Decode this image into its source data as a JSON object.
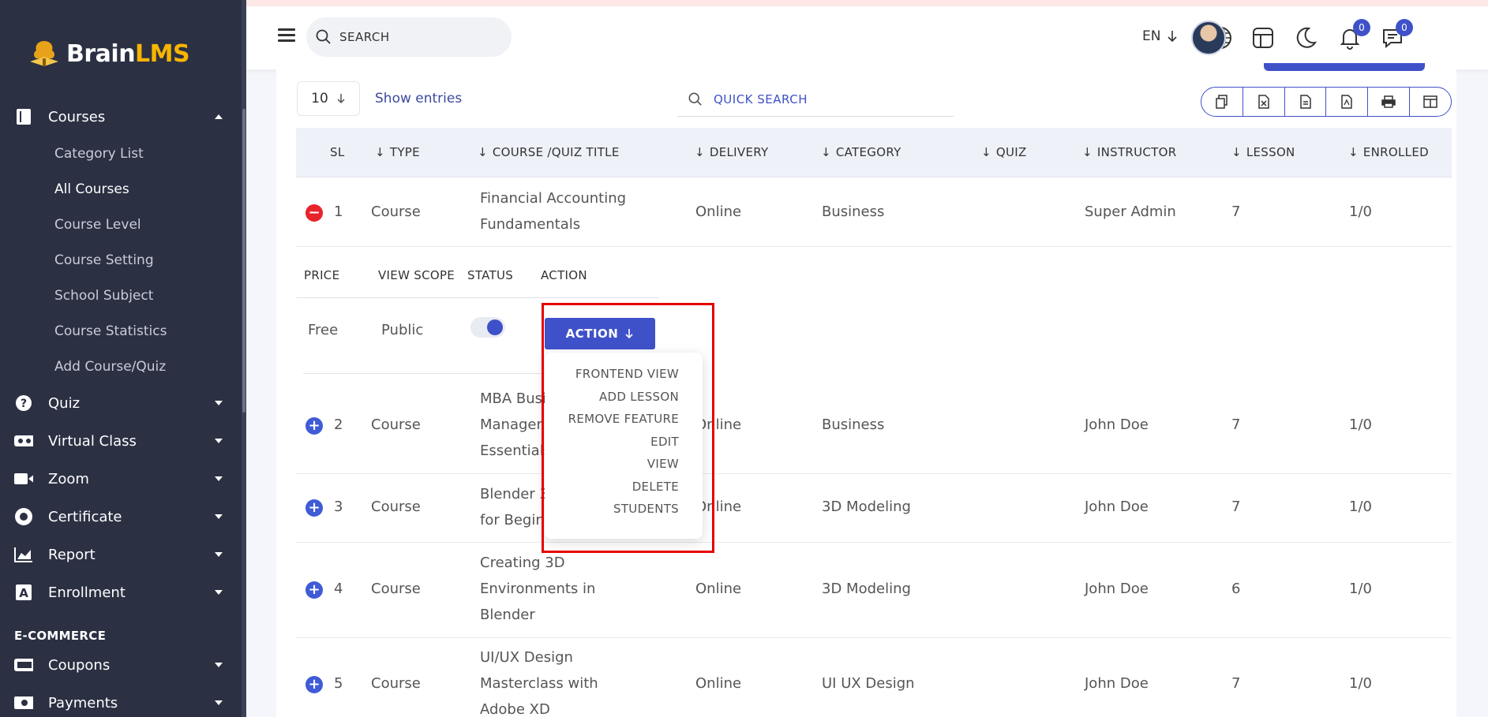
{
  "brand": {
    "name_a": "Brain",
    "name_b": "LMS"
  },
  "sidebar": {
    "courses": {
      "label": "Courses",
      "subitems": [
        "Category List",
        "All Courses",
        "Course Level",
        "Course Setting",
        "School Subject",
        "Course Statistics",
        "Add Course/Quiz"
      ],
      "active": "All Courses"
    },
    "items": [
      {
        "label": "Quiz",
        "icon": "question-icon"
      },
      {
        "label": "Virtual Class",
        "icon": "vr-icon"
      },
      {
        "label": "Zoom",
        "icon": "video-icon"
      },
      {
        "label": "Certificate",
        "icon": "certificate-icon"
      },
      {
        "label": "Report",
        "icon": "chart-icon"
      },
      {
        "label": "Enrollment",
        "icon": "enroll-icon"
      }
    ],
    "section_ecommerce": "E-COMMERCE",
    "ecommerce_items": [
      {
        "label": "Coupons",
        "icon": "coupon-icon"
      },
      {
        "label": "Payments",
        "icon": "payment-icon"
      }
    ]
  },
  "topbar": {
    "search_placeholder": "SEARCH",
    "language": "EN",
    "notifications_count": "0",
    "messages_count": "0"
  },
  "table_controls": {
    "entries_value": "10",
    "show_entries": "Show entries",
    "quick_search": "QUICK SEARCH"
  },
  "columns": [
    "SL",
    "TYPE",
    "COURSE /QUIZ TITLE",
    "DELIVERY",
    "CATEGORY",
    "QUIZ",
    "INSTRUCTOR",
    "LESSON",
    "ENROLLED"
  ],
  "rows": [
    {
      "sl": "1",
      "type": "Course",
      "title1": "Financial Accounting",
      "title2": "Fundamentals",
      "title3": "",
      "delivery": "Online",
      "category": "Business",
      "quiz": "",
      "instructor": "Super Admin",
      "lesson": "7",
      "enrolled": "1/0"
    },
    {
      "sl": "2",
      "type": "Course",
      "title1": "MBA Busi",
      "title2": "Manager",
      "title3": "Essentials",
      "delivery": "Online",
      "category": "Business",
      "quiz": "",
      "instructor": "John Doe",
      "lesson": "7",
      "enrolled": "1/0"
    },
    {
      "sl": "3",
      "type": "Course",
      "title1": "Blender 3",
      "title2": "for Begin",
      "title3": "",
      "delivery": "Online",
      "category": "3D Modeling",
      "quiz": "",
      "instructor": "John Doe",
      "lesson": "7",
      "enrolled": "1/0"
    },
    {
      "sl": "4",
      "type": "Course",
      "title1": "Creating 3D",
      "title2": "Environments in",
      "title3": "Blender",
      "delivery": "Online",
      "category": "3D Modeling",
      "quiz": "",
      "instructor": "John Doe",
      "lesson": "6",
      "enrolled": "1/0"
    },
    {
      "sl": "5",
      "type": "Course",
      "title1": "UI/UX Design",
      "title2": "Masterclass with",
      "title3": "Adobe XD",
      "delivery": "Online",
      "category": "UI UX Design",
      "quiz": "",
      "instructor": "John Doe",
      "lesson": "7",
      "enrolled": "1/0"
    }
  ],
  "child_row": {
    "headers": [
      "PRICE",
      "VIEW SCOPE",
      "STATUS",
      "ACTION"
    ],
    "price": "Free",
    "view_scope": "Public",
    "status_on": true,
    "action_label": "ACTION"
  },
  "action_menu": [
    "FRONTEND VIEW",
    "ADD LESSON",
    "REMOVE FEATURE",
    "EDIT",
    "VIEW",
    "DELETE",
    "STUDENTS"
  ],
  "colors": {
    "sidebar_bg": "#2b3043",
    "accent": "#3f51c9",
    "brand_yellow": "#f7b500",
    "highlight": "#e50000",
    "minus": "#e8232a"
  }
}
